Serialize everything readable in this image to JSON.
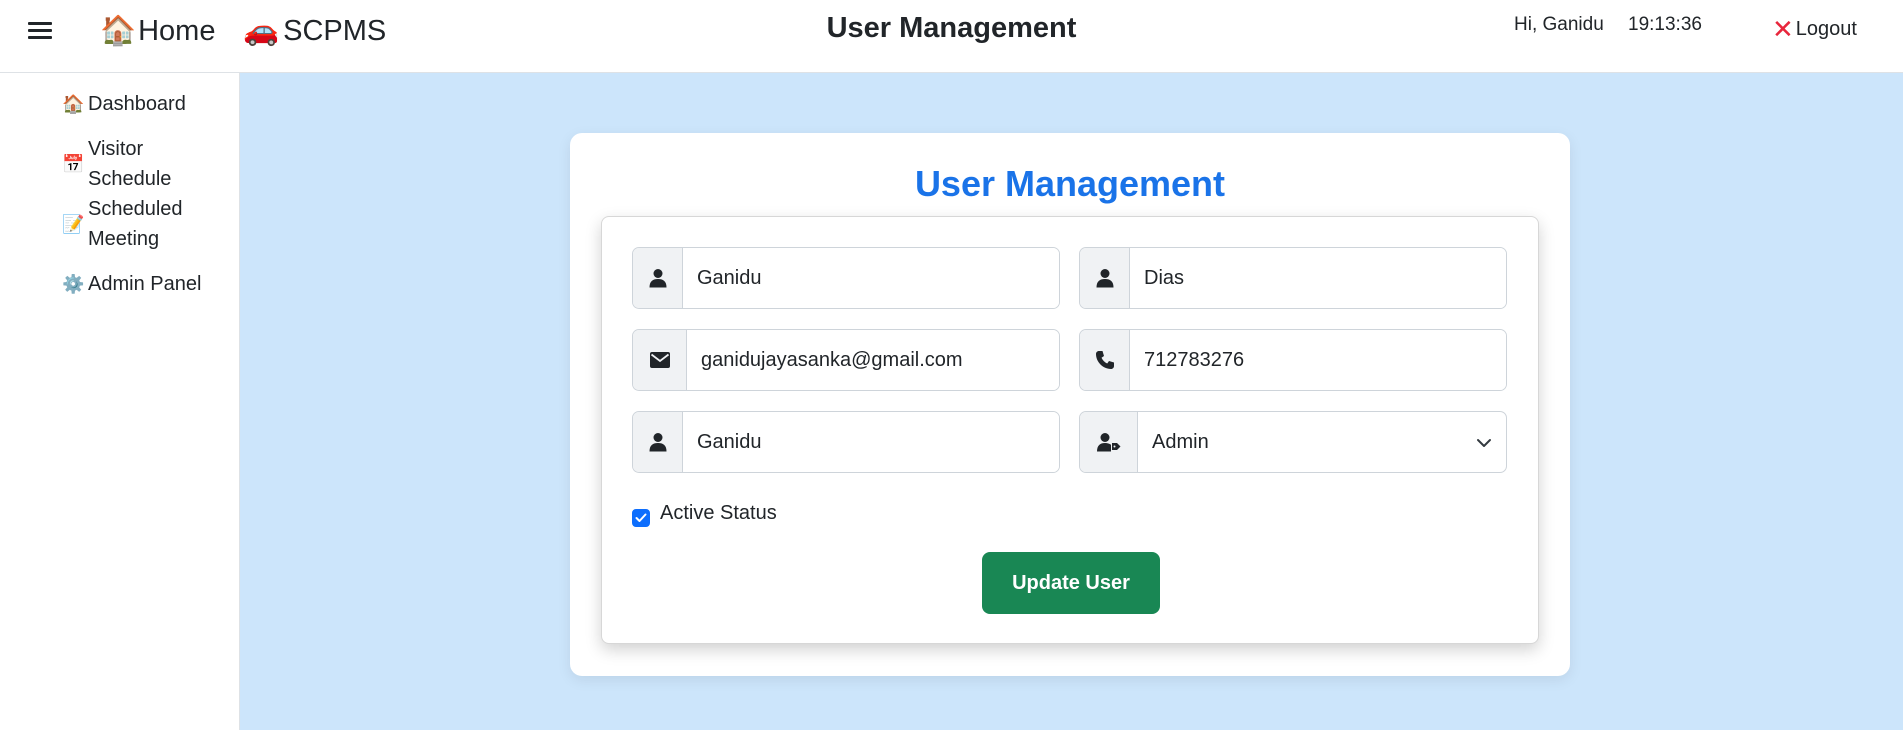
{
  "navbar": {
    "home_emoji": "🏠",
    "home_label": "Home",
    "brand_emoji": "🚗",
    "brand_label": "SCPMS",
    "page_title": "User Management",
    "greeting": "Hi, Ganidu",
    "clock": "19:13:36",
    "logout_label": "Logout"
  },
  "sidebar": {
    "items": [
      {
        "icon": "🏠",
        "label": "Dashboard"
      },
      {
        "icon": "📅",
        "label": "Visitor Schedule"
      },
      {
        "icon": "📝",
        "label": "Scheduled Meeting"
      },
      {
        "icon": "⚙️",
        "label": "Admin Panel"
      }
    ]
  },
  "form": {
    "title": "User Management",
    "first_name": "Ganidu",
    "last_name": "Dias",
    "email": "ganidujayasanka@gmail.com",
    "phone": "712783276",
    "username": "Ganidu",
    "role": "Admin",
    "active_status_label": "Active Status",
    "active_status_checked": true,
    "submit_label": "Update User"
  },
  "colors": {
    "main_bg": "#cce5fb",
    "title_blue": "#1a73e8",
    "button_green": "#198754",
    "checkbox_blue": "#0d6efd",
    "logout_red": "#e8263c"
  }
}
